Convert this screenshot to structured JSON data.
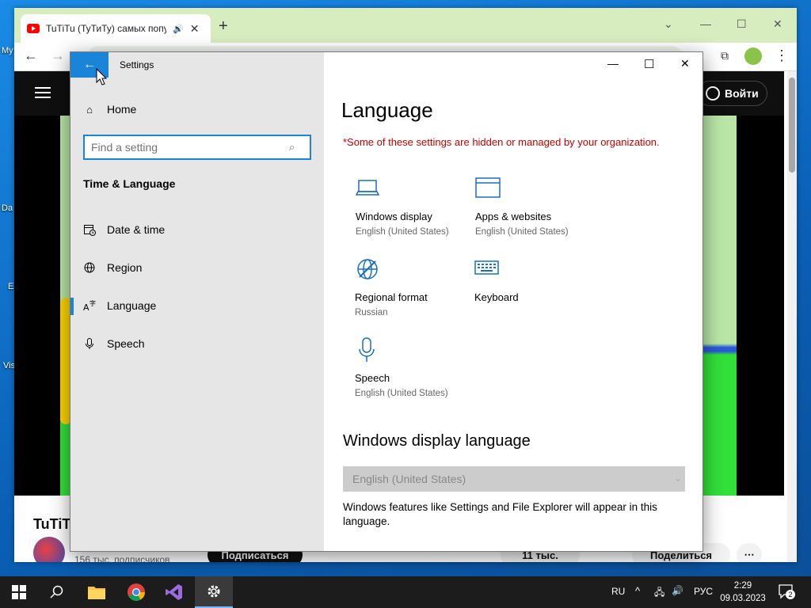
{
  "desktop": {
    "labels": [
      "My",
      "Da",
      "E",
      "Vis"
    ]
  },
  "browser": {
    "tab_title": "TuTiTu (ТуТиТу) самых попу",
    "new_tab_glyph": "+",
    "signin_label": "Войти",
    "channel_title": "TuTiT",
    "subscribers": "156 тыс. подписчиков",
    "subscribe_label": "Подписаться",
    "likes_label": "11 тыс.",
    "share_label": "Поделиться"
  },
  "settings": {
    "window_title": "Settings",
    "home_label": "Home",
    "search_placeholder": "Find a setting",
    "section_title": "Time & Language",
    "nav": [
      {
        "label": "Date & time",
        "icon": "calendar-clock-icon"
      },
      {
        "label": "Region",
        "icon": "globe-icon"
      },
      {
        "label": "Language",
        "icon": "language-icon"
      },
      {
        "label": "Speech",
        "icon": "microphone-icon"
      }
    ],
    "page_title": "Language",
    "warning": "*Some of these settings are hidden or managed by your organization.",
    "tiles": [
      {
        "label": "Windows display",
        "sub": "English (United States)",
        "icon": "laptop-icon"
      },
      {
        "label": "Apps & websites",
        "sub": "English (United States)",
        "icon": "browser-window-icon"
      },
      {
        "label": "Regional format",
        "sub": "Russian",
        "icon": "globe-format-icon"
      },
      {
        "label": "Keyboard",
        "sub": "",
        "icon": "keyboard-icon"
      },
      {
        "label": "Speech",
        "sub": "English (United States)",
        "icon": "microphone-icon"
      }
    ],
    "display_language_heading": "Windows display language",
    "display_language_value": "English (United States)",
    "display_language_desc": "Windows features like Settings and File Explorer will appear in this language.",
    "accent_color": "#1a84d9"
  },
  "taskbar": {
    "keyboard_lang": "RU",
    "input_lang": "РУС",
    "time": "2:29",
    "date": "09.03.2023",
    "notifications": "2"
  }
}
